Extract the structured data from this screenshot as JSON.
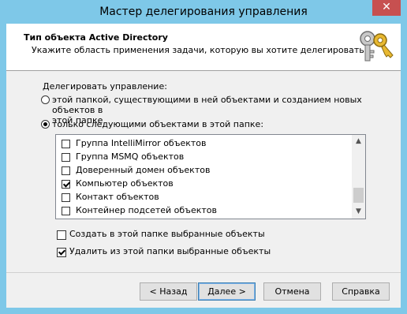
{
  "window": {
    "title": "Мастер делегирования управления",
    "close_glyph": "✕"
  },
  "header": {
    "title": "Тип объекта Active Directory",
    "subtitle": "Укажите область применения задачи, которую вы хотите делегировать.",
    "icon": "keys-icon"
  },
  "delegate": {
    "label": "Делегировать управление:",
    "options": [
      {
        "label_line1": "этой папкой, существующими в ней объектами и созданием новых объектов в",
        "label_line2": "этой папке",
        "selected": false
      },
      {
        "label_line1": "только следующими объектами в этой папке:",
        "selected": true
      }
    ]
  },
  "object_list": {
    "items": [
      {
        "label": "Группа IntelliMirror объектов",
        "checked": false
      },
      {
        "label": "Группа MSMQ объектов",
        "checked": false
      },
      {
        "label": "Доверенный домен объектов",
        "checked": false
      },
      {
        "label": "Компьютер объектов",
        "checked": true
      },
      {
        "label": "Контакт объектов",
        "checked": false
      },
      {
        "label": "Контейнер подсетей объектов",
        "checked": false
      }
    ],
    "scroll_up": "▲",
    "scroll_down": "▼"
  },
  "options": {
    "create": {
      "label": "Создать в этой папке выбранные объекты",
      "checked": false
    },
    "delete": {
      "label": "Удалить из этой папки выбранные объекты",
      "checked": true
    }
  },
  "buttons": {
    "back": "< Назад",
    "next": "Далее >",
    "cancel": "Отмена",
    "help": "Справка"
  }
}
